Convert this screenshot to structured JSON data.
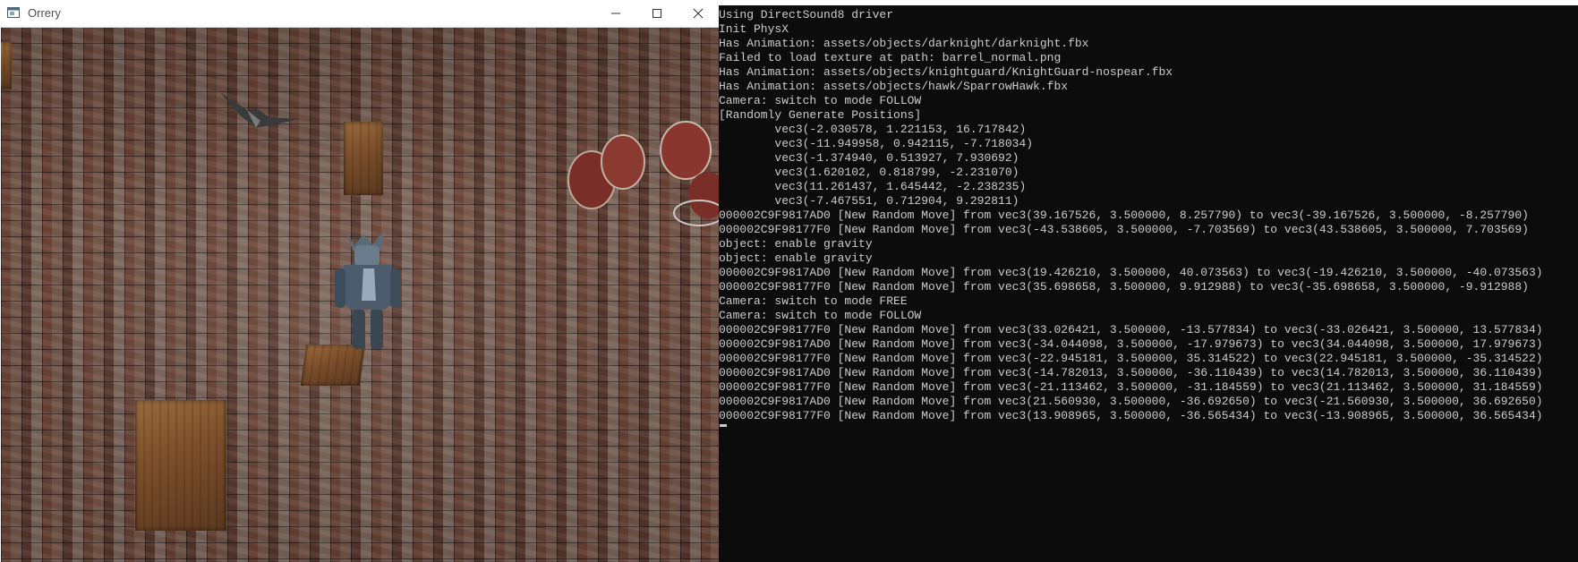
{
  "game_window": {
    "title": "Orrery",
    "icons": {
      "app": "app-window-icon",
      "minimize": "minimize-icon",
      "maximize": "maximize-icon",
      "close": "close-icon"
    }
  },
  "console": {
    "lines": [
      "Using DirectSound8 driver",
      "Init PhysX",
      "Has Animation: assets/objects/darknight/darknight.fbx",
      "Failed to load texture at path: barrel_normal.png",
      "Has Animation: assets/objects/knightguard/KnightGuard-nospear.fbx",
      "Has Animation: assets/objects/hawk/SparrowHawk.fbx",
      "Camera: switch to mode FOLLOW",
      "[Randomly Generate Positions]",
      "        vec3(-2.030578, 1.221153, 16.717842)",
      "        vec3(-11.949958, 0.942115, -7.718034)",
      "        vec3(-1.374940, 0.513927, 7.930692)",
      "        vec3(1.620102, 0.818799, -2.231070)",
      "        vec3(11.261437, 1.645442, -2.238235)",
      "        vec3(-7.467551, 0.712904, 9.292811)",
      "000002C9F9817AD0 [New Random Move] from vec3(39.167526, 3.500000, 8.257790) to vec3(-39.167526, 3.500000, -8.257790)",
      "000002C9F98177F0 [New Random Move] from vec3(-43.538605, 3.500000, -7.703569) to vec3(43.538605, 3.500000, 7.703569)",
      "object: enable gravity",
      "object: enable gravity",
      "000002C9F9817AD0 [New Random Move] from vec3(19.426210, 3.500000, 40.073563) to vec3(-19.426210, 3.500000, -40.073563)",
      "000002C9F98177F0 [New Random Move] from vec3(35.698658, 3.500000, 9.912988) to vec3(-35.698658, 3.500000, -9.912988)",
      "Camera: switch to mode FREE",
      "Camera: switch to mode FOLLOW",
      "000002C9F98177F0 [New Random Move] from vec3(33.026421, 3.500000, -13.577834) to vec3(-33.026421, 3.500000, 13.577834)",
      "000002C9F9817AD0 [New Random Move] from vec3(-34.044098, 3.500000, -17.979673) to vec3(34.044098, 3.500000, 17.979673)",
      "000002C9F98177F0 [New Random Move] from vec3(-22.945181, 3.500000, 35.314522) to vec3(22.945181, 3.500000, -35.314522)",
      "000002C9F9817AD0 [New Random Move] from vec3(-14.782013, 3.500000, -36.110439) to vec3(14.782013, 3.500000, 36.110439)",
      "000002C9F98177F0 [New Random Move] from vec3(-21.113462, 3.500000, -31.184559) to vec3(21.113462, 3.500000, 31.184559)",
      "000002C9F9817AD0 [New Random Move] from vec3(21.560930, 3.500000, -36.692650) to vec3(-21.560930, 3.500000, 36.692650)",
      "000002C9F98177F0 [New Random Move] from vec3(13.908965, 3.500000, -36.565434) to vec3(-13.908965, 3.500000, 36.565434)"
    ]
  },
  "colors": {
    "console_bg": "#0c0c0c",
    "console_text": "#cccccc",
    "titlebar_bg": "#ffffff"
  }
}
